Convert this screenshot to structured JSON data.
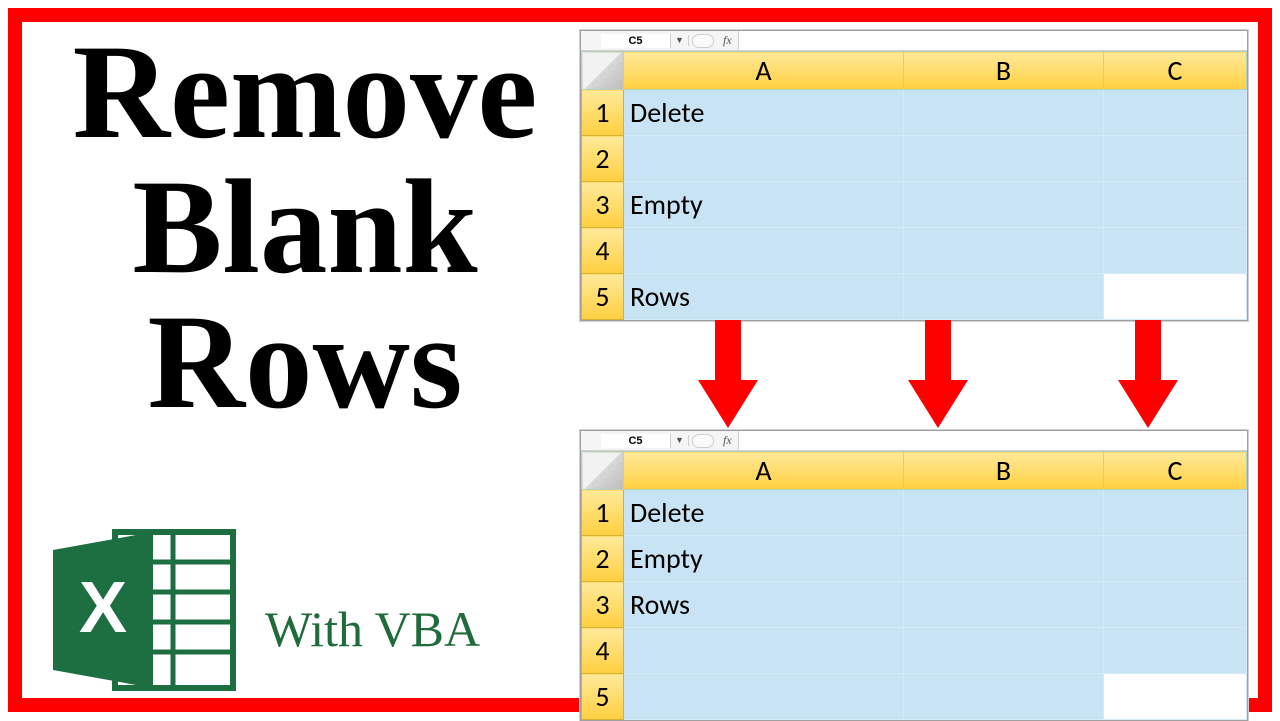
{
  "title": {
    "line1": "Remove",
    "line2": "Blank",
    "line3": "Rows"
  },
  "subtitle": "With VBA",
  "namebox": "C5",
  "fx": "fx",
  "columns": [
    "A",
    "B",
    "C"
  ],
  "sheet_before": {
    "rows": [
      {
        "n": "1",
        "a": "Delete",
        "b": "",
        "c": ""
      },
      {
        "n": "2",
        "a": "",
        "b": "",
        "c": ""
      },
      {
        "n": "3",
        "a": "Empty",
        "b": "",
        "c": ""
      },
      {
        "n": "4",
        "a": "",
        "b": "",
        "c": ""
      },
      {
        "n": "5",
        "a": "Rows",
        "b": "",
        "c": ""
      }
    ]
  },
  "sheet_after": {
    "rows": [
      {
        "n": "1",
        "a": "Delete",
        "b": "",
        "c": ""
      },
      {
        "n": "2",
        "a": "Empty",
        "b": "",
        "c": ""
      },
      {
        "n": "3",
        "a": "Rows",
        "b": "",
        "c": ""
      },
      {
        "n": "4",
        "a": "",
        "b": "",
        "c": ""
      },
      {
        "n": "5",
        "a": "",
        "b": "",
        "c": ""
      }
    ]
  }
}
